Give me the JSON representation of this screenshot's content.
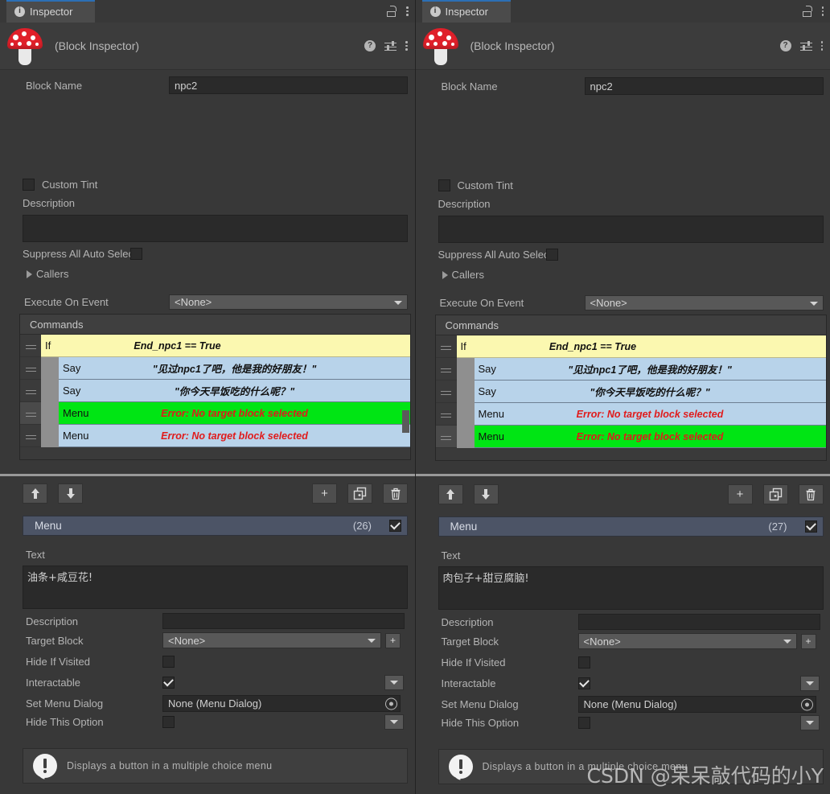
{
  "window": {
    "tab_label": "Inspector",
    "info_badge": "i",
    "lock_icon": "lock-icon",
    "kebab_icon": "more-options-icon"
  },
  "object_header": {
    "title": "(Block Inspector)",
    "help_icon": "?",
    "preset_icon": "preset-icon",
    "menu_icon": "more-options-icon",
    "logo": "fungus-mushroom-logo"
  },
  "block": {
    "block_name_label": "Block Name",
    "block_name_value": "npc2",
    "custom_tint_label": "Custom Tint",
    "custom_tint_checked": false,
    "description_label": "Description",
    "description_value": "",
    "suppress_label": "Suppress All Auto Selec",
    "suppress_checked": false,
    "callers_label": "Callers",
    "execute_on_event_label": "Execute On Event",
    "execute_on_event_value": "<None>"
  },
  "commands": {
    "header": "Commands",
    "rows": [
      {
        "name": "If",
        "summary": "End_npc1 == True",
        "type": "if",
        "indent": false,
        "selected_handle": false,
        "highlight": false,
        "error": false
      },
      {
        "name": "Say",
        "summary": "\"见过npc1了吧，他是我的好朋友！\"",
        "type": "say",
        "indent": true,
        "selected_handle": false,
        "highlight": false,
        "error": false
      },
      {
        "name": "Say",
        "summary": "\"你今天早饭吃的什么呢？\"",
        "type": "say",
        "indent": true,
        "selected_handle": false,
        "highlight": false,
        "error": false
      },
      {
        "name": "Menu",
        "summary": "Error: No target block selected",
        "type": "menu",
        "indent": true,
        "selected_handle": false,
        "highlight": false,
        "error": true
      },
      {
        "name": "Menu",
        "summary": "Error: No target block selected",
        "type": "menu",
        "indent": true,
        "selected_handle": false,
        "highlight": false,
        "error": true
      }
    ]
  },
  "left_panel": {
    "selected_command_index": 3,
    "inspector": {
      "move_up_icon": "arrow-up-icon",
      "move_down_icon": "arrow-down-icon",
      "add_icon": "+",
      "duplicate_icon": "duplicate-icon",
      "delete_icon": "trash-icon",
      "command_title": "Menu",
      "command_index": "(26)",
      "enabled_checked": true,
      "text_label": "Text",
      "text_value": "油条+咸豆花!",
      "description_label": "Description",
      "description_value": "",
      "target_block_label": "Target Block",
      "target_block_value": "<None>",
      "target_block_add": "+",
      "hide_if_visited_label": "Hide If Visited",
      "hide_if_visited_checked": false,
      "interactable_label": "Interactable",
      "interactable_checked": true,
      "set_menu_dialog_label": "Set Menu Dialog",
      "set_menu_dialog_value": "None (Menu Dialog)",
      "hide_this_option_label": "Hide This Option",
      "hide_this_option_checked": false,
      "help_text": "Displays a button in a multiple choice menu"
    }
  },
  "right_panel": {
    "selected_command_index": 4,
    "inspector": {
      "move_up_icon": "arrow-up-icon",
      "move_down_icon": "arrow-down-icon",
      "add_icon": "+",
      "duplicate_icon": "duplicate-icon",
      "delete_icon": "trash-icon",
      "command_title": "Menu",
      "command_index": "(27)",
      "enabled_checked": true,
      "text_label": "Text",
      "text_value": "肉包子+甜豆腐脑!",
      "description_label": "Description",
      "description_value": "",
      "target_block_label": "Target Block",
      "target_block_value": "<None>",
      "target_block_add": "+",
      "hide_if_visited_label": "Hide If Visited",
      "hide_if_visited_checked": false,
      "interactable_label": "Interactable",
      "interactable_checked": true,
      "set_menu_dialog_label": "Set Menu Dialog",
      "set_menu_dialog_value": "None (Menu Dialog)",
      "hide_this_option_label": "Hide This Option",
      "hide_this_option_checked": false,
      "help_text": "Displays a button in a multiple choice menu"
    }
  },
  "watermark": "CSDN @呆呆敲代码的小Y",
  "colors": {
    "bg": "#383838",
    "panel_header": "#3c3c3c",
    "tab_accent": "#2c6fb5",
    "if_row": "#fbf8b0",
    "say_row": "#b8d3ea",
    "selected_row": "#00e514",
    "error_text": "#e01b1b",
    "command_title_bar": "#4c5466"
  }
}
